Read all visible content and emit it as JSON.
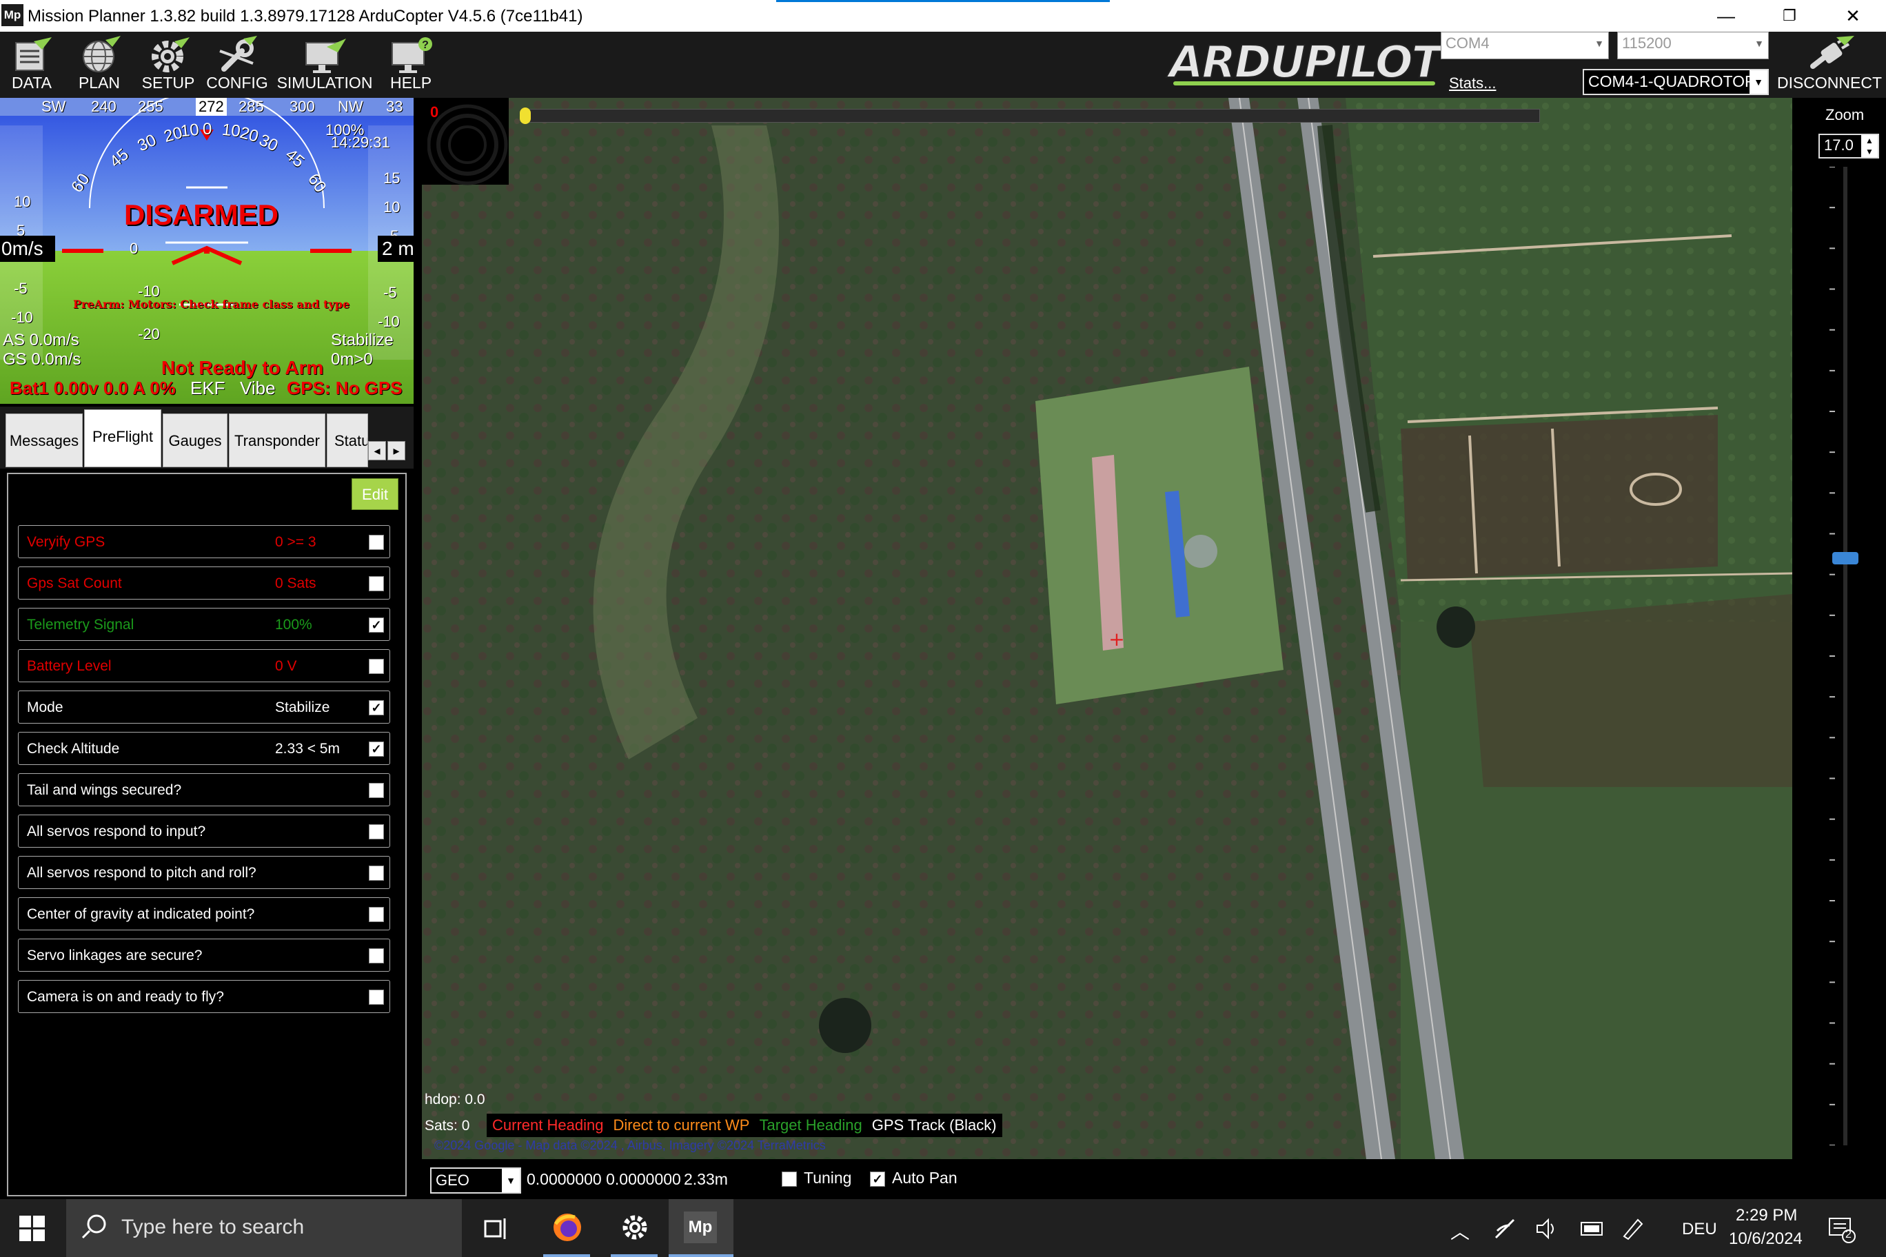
{
  "window": {
    "app_icon": "Mp",
    "title": "Mission Planner 1.3.82 build 1.3.8979.17128 ArduCopter V4.5.6 (7ce11b41)",
    "minimize": "—",
    "maximize": "❐",
    "close": "✕"
  },
  "toolbar": {
    "items": [
      {
        "label": "DATA",
        "icon": "data-icon"
      },
      {
        "label": "PLAN",
        "icon": "globe-icon"
      },
      {
        "label": "SETUP",
        "icon": "gear-icon"
      },
      {
        "label": "CONFIG",
        "icon": "wrench-icon"
      },
      {
        "label": "SIMULATION",
        "icon": "monitor-plane-icon"
      },
      {
        "label": "HELP",
        "icon": "help-monitor-icon"
      }
    ],
    "brand": "ARDUPILOT",
    "port": "COM4",
    "baud": "115200",
    "stats": "Stats...",
    "connection": "COM4-1-QUADROTOR",
    "disconnect": "DISCONNECT"
  },
  "hud": {
    "compass": [
      "SW",
      "240",
      "255",
      "272",
      "285",
      "300",
      "NW",
      "33"
    ],
    "heading_value": "272",
    "status": "DISARMED",
    "prearm": "PreArm: Motors: Check frame class and type",
    "airspeed_box": "0m/s",
    "alt_box": "2 m",
    "time": "14:29:31",
    "pct": "100%",
    "as": "AS 0.0m/s",
    "gs": "GS 0.0m/s",
    "mode": "Stabilize",
    "wp_dist": "0m>0",
    "not_ready": "Not Ready to Arm",
    "bottom_left": "Bat1 0.00v 0.0 A 0%",
    "ekf": "EKF",
    "vibe": "Vibe",
    "gps": "GPS: No GPS",
    "pitch_labels": [
      "10",
      "0",
      "-10",
      "-20"
    ],
    "roll_labels": [
      "60",
      "45",
      "30",
      "20",
      "10",
      "0",
      "10",
      "20",
      "30",
      "45",
      "60"
    ],
    "speed_ticks": [
      "10",
      "5",
      "-5",
      "-10"
    ],
    "alt_ticks": [
      "15",
      "10",
      "5",
      "-5",
      "-10"
    ]
  },
  "tabs": {
    "items": [
      "Messages",
      "PreFlight",
      "Gauges",
      "Transponder",
      "Statu"
    ],
    "active": "PreFlight",
    "scroll_left": "◂",
    "scroll_right": "▸"
  },
  "preflight": {
    "edit": "Edit",
    "checks": [
      {
        "desc": "Veryify GPS",
        "val": "0 >= 3",
        "state": "fail",
        "checked": false
      },
      {
        "desc": "Gps Sat Count",
        "val": "0 Sats",
        "state": "fail",
        "checked": false
      },
      {
        "desc": "Telemetry Signal",
        "val": "100%",
        "state": "ok",
        "checked": true
      },
      {
        "desc": "Battery Level",
        "val": "0 V",
        "state": "fail",
        "checked": false
      },
      {
        "desc": "Mode",
        "val": "Stabilize",
        "state": "normal",
        "checked": true
      },
      {
        "desc": "Check Altitude",
        "val": "2.33 < 5m",
        "state": "normal",
        "checked": true
      },
      {
        "desc": "Tail and wings secured?",
        "val": "",
        "state": "normal",
        "checked": false
      },
      {
        "desc": "All servos respond to input?",
        "val": "",
        "state": "normal",
        "checked": false
      },
      {
        "desc": "All servos respond to pitch and roll?",
        "val": "",
        "state": "normal",
        "checked": false
      },
      {
        "desc": "Center of gravity at indicated point?",
        "val": "",
        "state": "normal",
        "checked": false
      },
      {
        "desc": "Servo linkages are secure?",
        "val": "",
        "state": "normal",
        "checked": false
      },
      {
        "desc": "Camera is on and ready to fly?",
        "val": "",
        "state": "normal",
        "checked": false
      }
    ]
  },
  "map": {
    "compass_zero": "0",
    "hdop": "hdop: 0.0",
    "sats": "Sats: 0",
    "legend": [
      {
        "label": "Current Heading",
        "color": "#ff2a2a"
      },
      {
        "label": "Direct to current WP",
        "color": "#ff8c1a"
      },
      {
        "label": "Target Heading",
        "color": "#2aa02a"
      },
      {
        "label": "GPS Track (Black)",
        "color": "#ffffff"
      }
    ],
    "copyright": "©2024 Google - Map data ©2024 , Airbus, Imagery ©2024 TerraMetrics",
    "zoom_label": "Zoom",
    "zoom_value": "17.0",
    "zoom_level": 0.6
  },
  "statusbar": {
    "coord_type": "GEO",
    "coords": "0.0000000 0.0000000",
    "alt": "2.33m",
    "tuning": "Tuning",
    "tuning_checked": false,
    "autopan": "Auto Pan",
    "autopan_checked": true
  },
  "taskbar": {
    "search_placeholder": "Type here to search",
    "language": "DEU",
    "time": "2:29 PM",
    "date": "10/6/2024",
    "notifications": "2",
    "app_label": "Mp"
  }
}
